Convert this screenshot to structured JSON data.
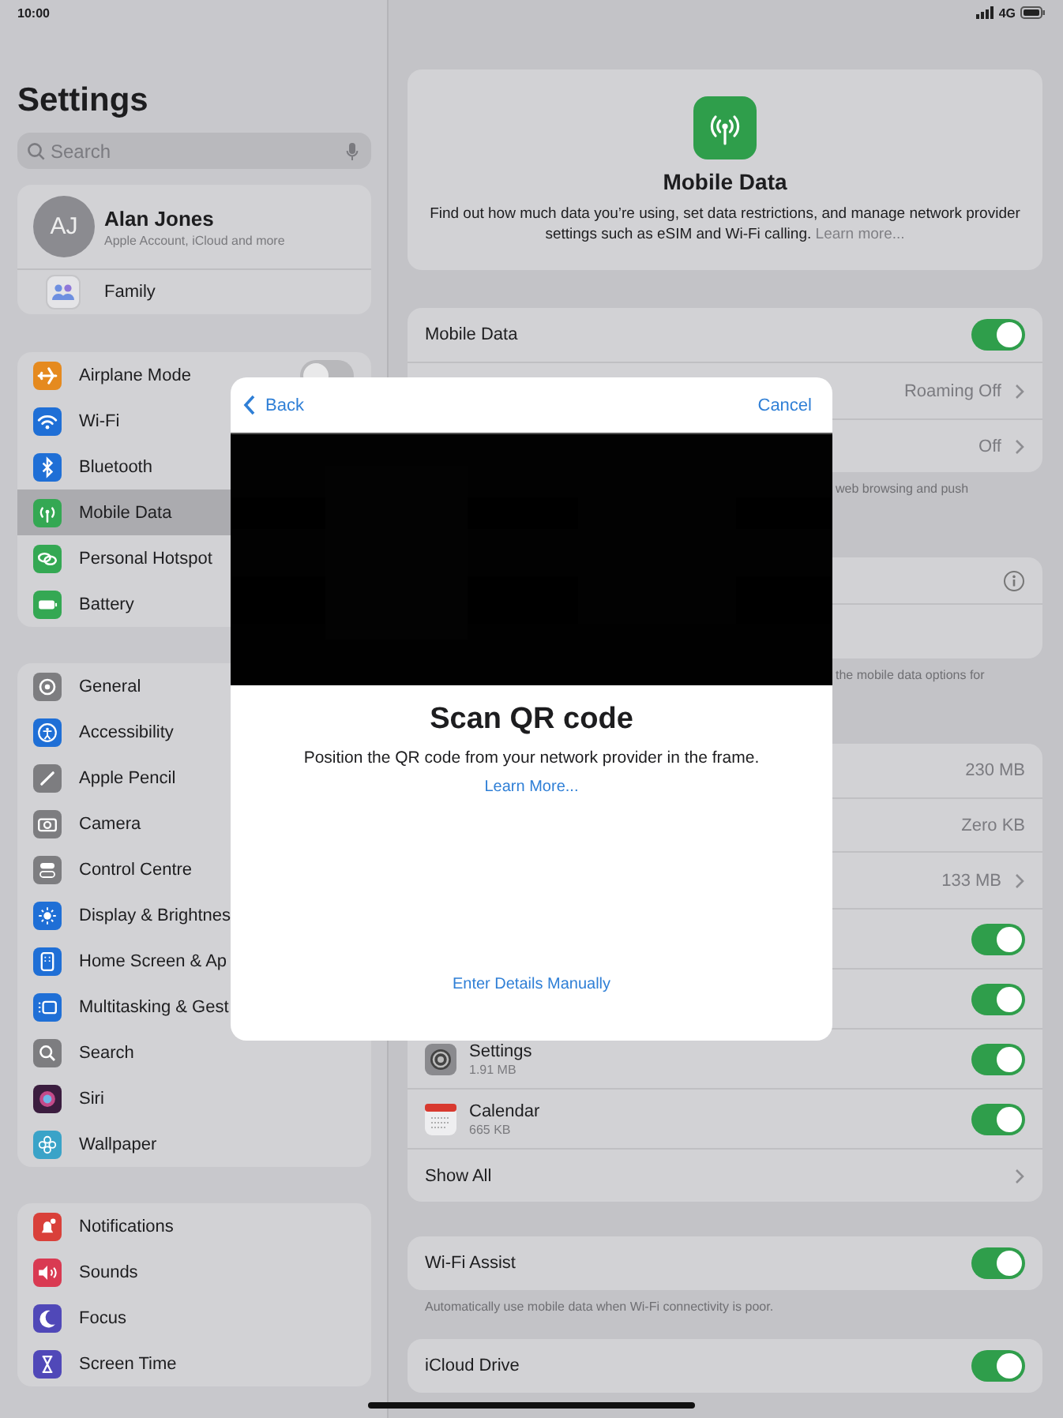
{
  "status_bar": {
    "time": "10:00",
    "network": "4G"
  },
  "sidebar": {
    "title": "Settings",
    "search": {
      "placeholder": "Search"
    },
    "account": {
      "initials": "AJ",
      "name": "Alan Jones",
      "subtitle": "Apple Account, iCloud and more"
    },
    "family": {
      "label": "Family"
    },
    "groups": [
      {
        "items": [
          {
            "label": "Airplane Mode",
            "kind": "toggle",
            "on": false,
            "selected": false,
            "color": "#e58a1f"
          },
          {
            "label": "Wi-Fi",
            "kind": "link",
            "selected": false,
            "color": "#1f6fd6"
          },
          {
            "label": "Bluetooth",
            "kind": "link",
            "selected": false,
            "color": "#1f6fd6"
          },
          {
            "label": "Mobile Data",
            "kind": "link",
            "selected": true,
            "color": "#34a853"
          },
          {
            "label": "Personal Hotspot",
            "kind": "link",
            "selected": false,
            "color": "#34a853"
          },
          {
            "label": "Battery",
            "kind": "link",
            "selected": false,
            "color": "#34a853"
          }
        ]
      },
      {
        "items": [
          {
            "label": "General",
            "kind": "link",
            "selected": false,
            "color": "#7d7d80"
          },
          {
            "label": "Accessibility",
            "kind": "link",
            "selected": false,
            "color": "#1f6fd6"
          },
          {
            "label": "Apple Pencil",
            "kind": "link",
            "selected": false,
            "color": "#7d7d80"
          },
          {
            "label": "Camera",
            "kind": "link",
            "selected": false,
            "color": "#7d7d80"
          },
          {
            "label": "Control Centre",
            "kind": "link",
            "selected": false,
            "color": "#7d7d80"
          },
          {
            "label": "Display & Brightnes",
            "kind": "link",
            "selected": false,
            "color": "#1f6fd6"
          },
          {
            "label": "Home Screen & Ap",
            "kind": "link",
            "selected": false,
            "color": "#1f6fd6"
          },
          {
            "label": "Multitasking & Gest",
            "kind": "link",
            "selected": false,
            "color": "#1f6fd6"
          },
          {
            "label": "Search",
            "kind": "link",
            "selected": false,
            "color": "#7d7d80"
          },
          {
            "label": "Siri",
            "kind": "link",
            "selected": false,
            "color": "#3b1d3f"
          },
          {
            "label": "Wallpaper",
            "kind": "link",
            "selected": false,
            "color": "#3aa3c8"
          }
        ]
      },
      {
        "items": [
          {
            "label": "Notifications",
            "kind": "link",
            "selected": false,
            "color": "#d9403a"
          },
          {
            "label": "Sounds",
            "kind": "link",
            "selected": false,
            "color": "#d93a52"
          },
          {
            "label": "Focus",
            "kind": "link",
            "selected": false,
            "color": "#5048b8"
          },
          {
            "label": "Screen Time",
            "kind": "link",
            "selected": false,
            "color": "#5048b8"
          }
        ]
      }
    ]
  },
  "header": {
    "title": "Mobile Data",
    "description": "Find out how much data you’re using, set data restrictions, and manage network provider settings such as eSIM and Wi-Fi calling.",
    "link": "Learn more..."
  },
  "sections": [
    {
      "kind": "group",
      "rows": [
        {
          "kind": "toggle",
          "label": "Mobile Data",
          "on": true
        },
        {
          "kind": "link",
          "value": "Roaming Off"
        },
        {
          "kind": "link",
          "value": "Off"
        }
      ]
    },
    {
      "kind": "caption",
      "text": "web browsing and push"
    },
    {
      "kind": "group",
      "rows": [
        {
          "kind": "info"
        },
        {
          "kind": "blank"
        }
      ]
    },
    {
      "kind": "caption",
      "text": "the mobile data options for"
    },
    {
      "kind": "group",
      "rows": [
        {
          "kind": "value",
          "value": "230 MB"
        },
        {
          "kind": "value",
          "value": "Zero KB"
        },
        {
          "kind": "link",
          "value": "133 MB"
        },
        {
          "kind": "toggle",
          "on": true
        },
        {
          "kind": "toggle",
          "on": true
        },
        {
          "kind": "app",
          "label": "Settings",
          "sub": "1.91 MB",
          "on": true
        },
        {
          "kind": "app",
          "label": "Calendar",
          "sub": "665 KB",
          "on": true
        },
        {
          "kind": "link",
          "label": "Show All"
        }
      ]
    },
    {
      "kind": "group",
      "rows": [
        {
          "kind": "toggle",
          "label": "Wi-Fi Assist",
          "on": true
        }
      ]
    },
    {
      "kind": "caption",
      "text": "Automatically use mobile data when Wi-Fi connectivity is poor."
    },
    {
      "kind": "group",
      "rows": [
        {
          "kind": "toggle",
          "label": "iCloud Drive",
          "on": true
        }
      ]
    }
  ],
  "modal": {
    "back": "Back",
    "cancel": "Cancel",
    "title": "Scan QR code",
    "description": "Position the QR code from your network provider in the frame.",
    "link": "Learn More...",
    "manual": "Enter Details Manually"
  }
}
